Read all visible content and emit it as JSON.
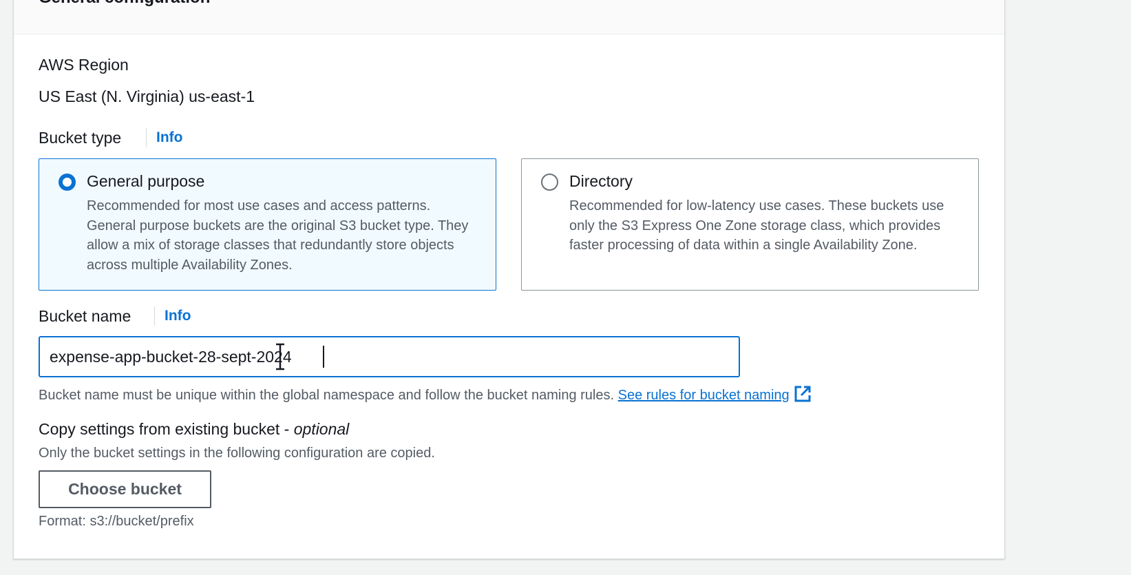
{
  "section": {
    "title": "General configuration"
  },
  "region": {
    "label": "AWS Region",
    "value": "US East (N. Virginia) us-east-1"
  },
  "bucket_type": {
    "label": "Bucket type",
    "info": "Info",
    "options": [
      {
        "title": "General purpose",
        "description": "Recommended for most use cases and access patterns. General purpose buckets are the original S3 bucket type. They allow a mix of storage classes that redundantly store objects across multiple Availability Zones.",
        "selected": true
      },
      {
        "title": "Directory",
        "description": "Recommended for low-latency use cases. These buckets use only the S3 Express One Zone storage class, which provides faster processing of data within a single Availability Zone.",
        "selected": false
      }
    ]
  },
  "bucket_name": {
    "label": "Bucket name",
    "info": "Info",
    "value": "expense-app-bucket-28-sept-2024",
    "hint": "Bucket name must be unique within the global namespace and follow the bucket naming rules.",
    "rules_link": "See rules for bucket naming"
  },
  "copy_settings": {
    "label": "Copy settings from existing bucket - ",
    "label_optional": "optional",
    "description": "Only the bucket settings in the following configuration are copied.",
    "button": "Choose bucket",
    "format_hint": "Format: s3://bucket/prefix"
  },
  "colors": {
    "accent": "#0972d3",
    "selected_tile_bg": "#f1faff",
    "text_primary": "#16191f",
    "text_secondary": "#545b64"
  },
  "icons": {
    "external_link": "external-link-icon",
    "text_cursor": "text-cursor-icon"
  }
}
